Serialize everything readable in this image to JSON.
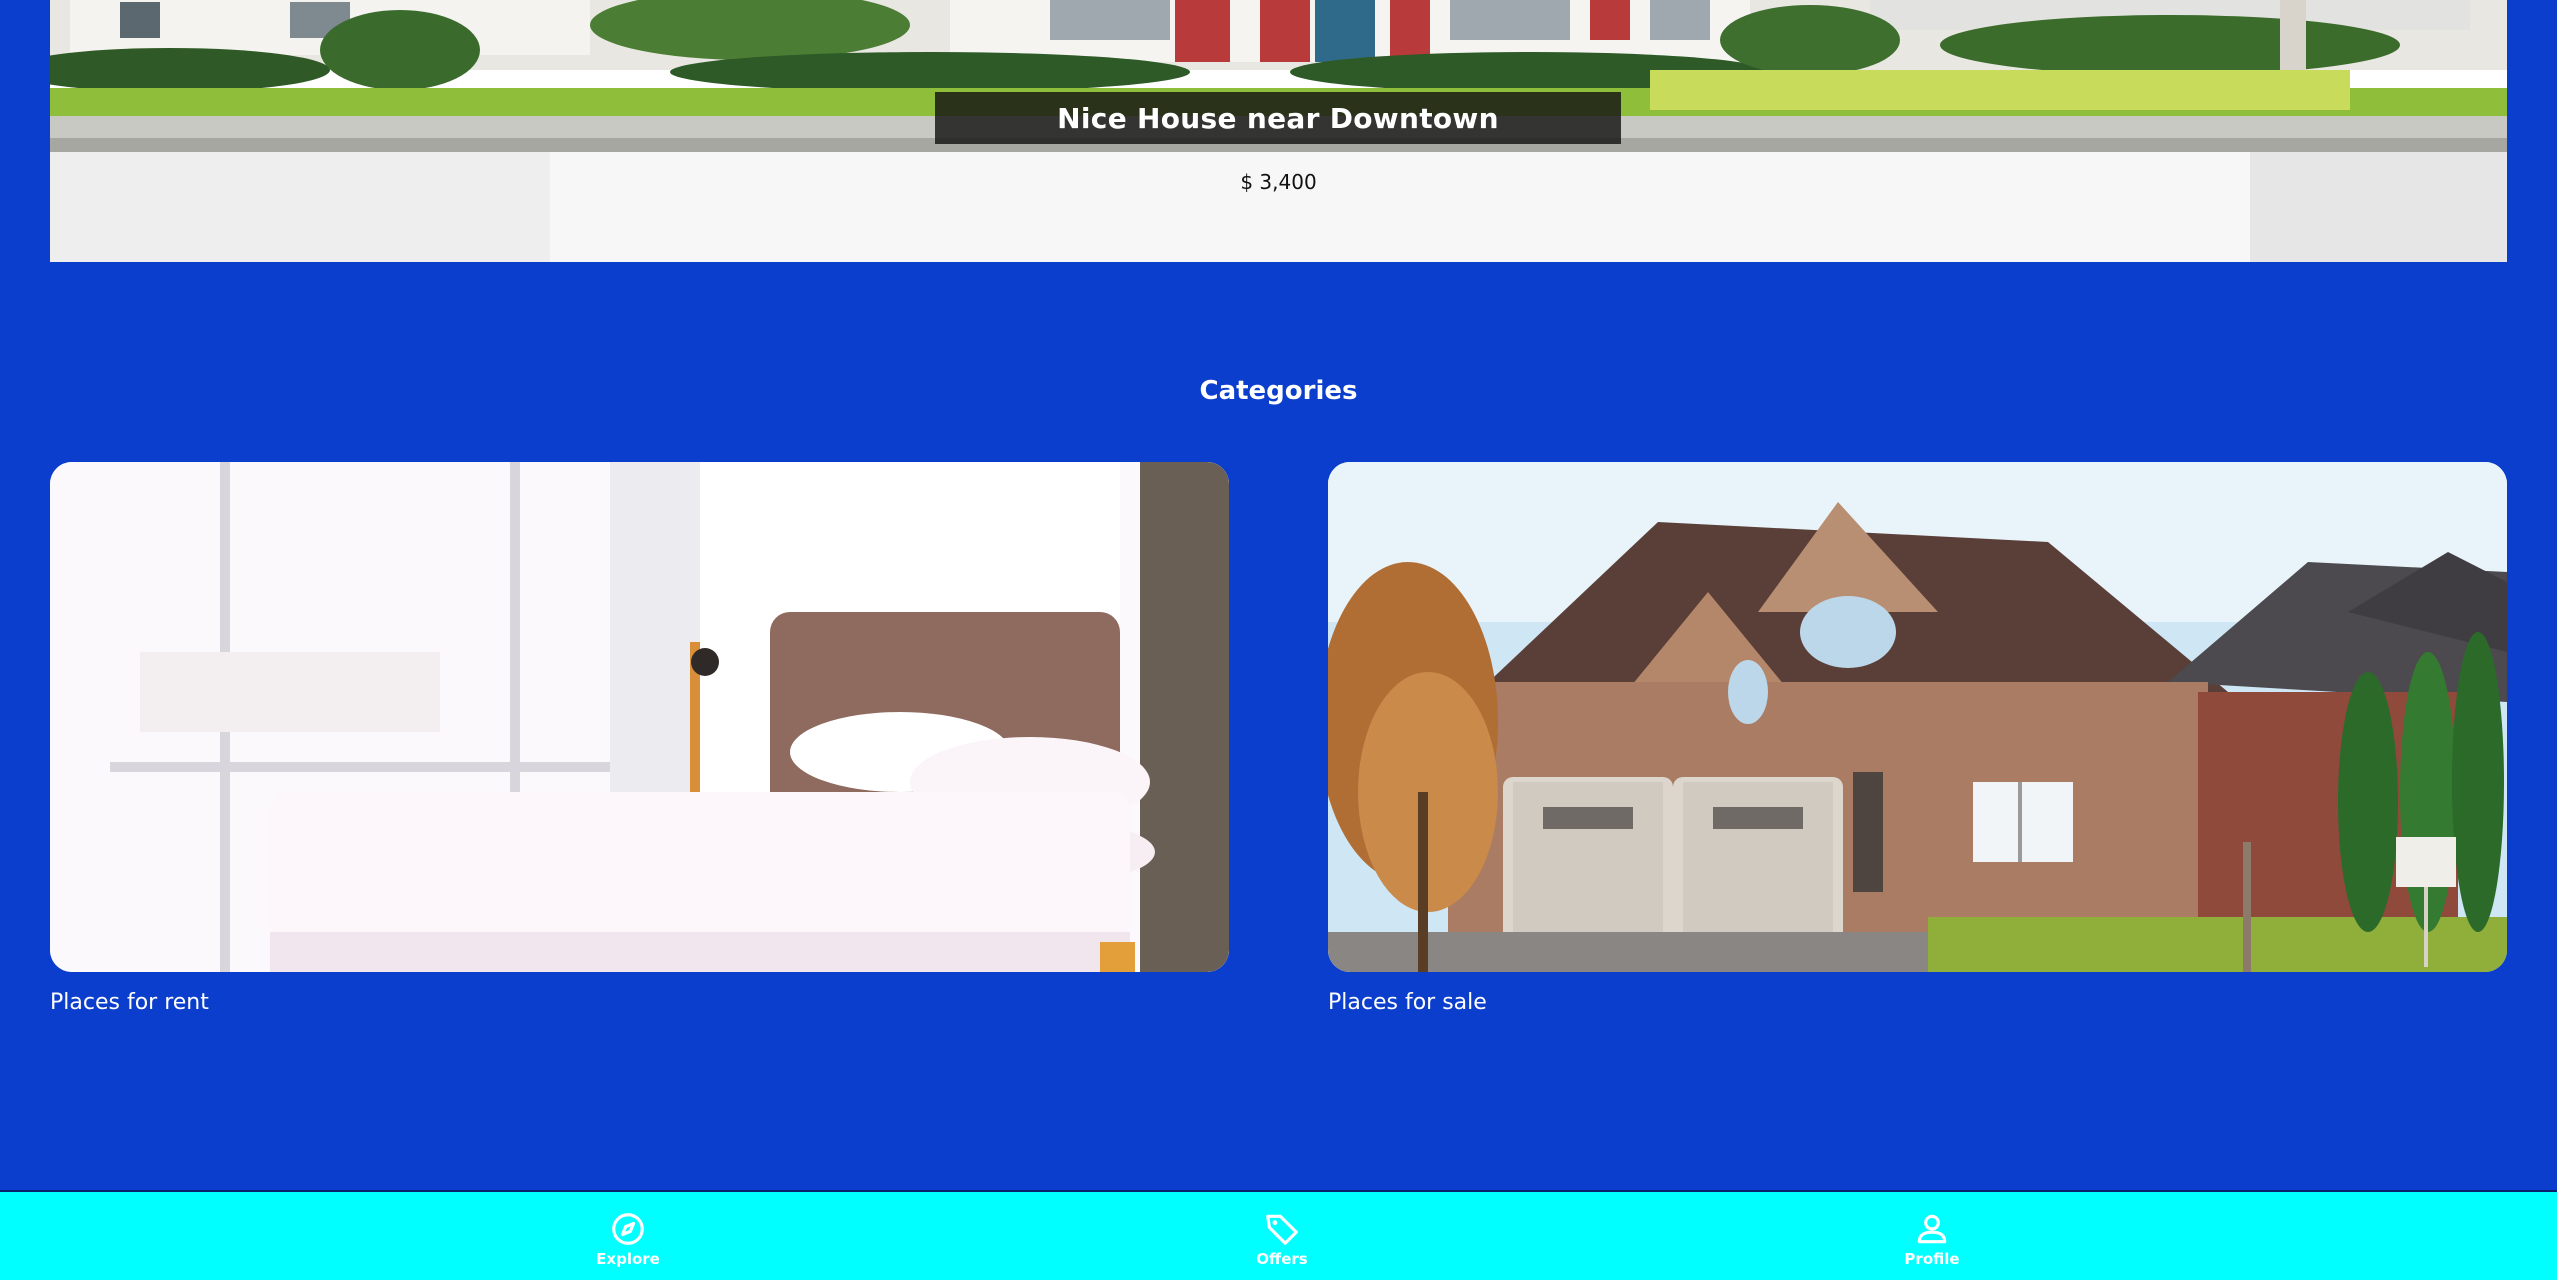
{
  "featured": {
    "title": "Nice House near Downtown",
    "price": "$ 3,400"
  },
  "categories": {
    "heading": "Categories",
    "items": [
      {
        "label": "Places for rent"
      },
      {
        "label": "Places for sale"
      }
    ]
  },
  "bottom_nav": {
    "items": [
      {
        "label": "Explore",
        "icon": "compass-icon"
      },
      {
        "label": "Offers",
        "icon": "tag-icon"
      },
      {
        "label": "Profile",
        "icon": "person-icon"
      }
    ]
  },
  "colors": {
    "background": "#0b3ecc",
    "nav_background": "#00ffff",
    "title_bar": "#141414"
  }
}
